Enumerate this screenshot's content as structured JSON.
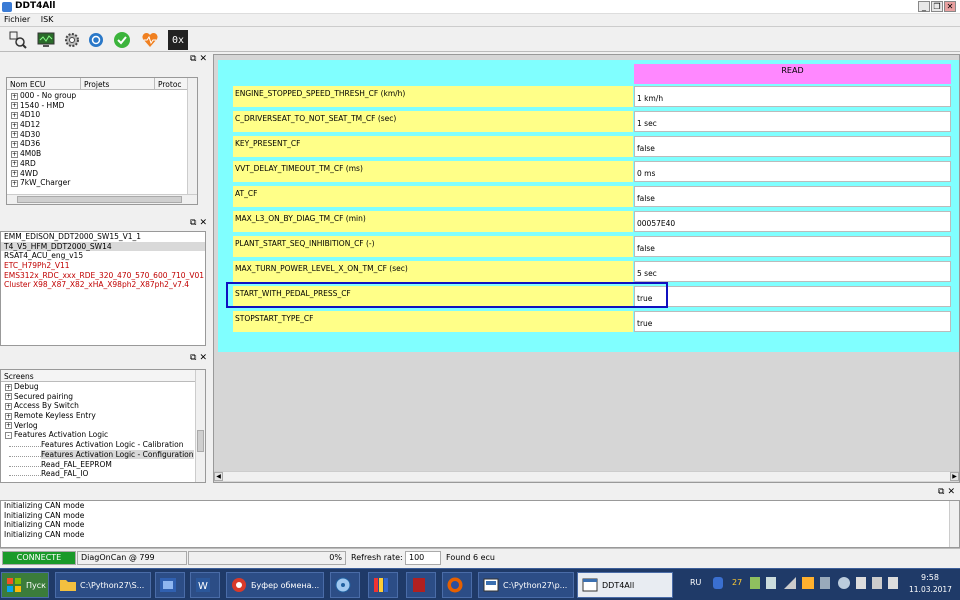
{
  "window": {
    "title": "DDT4All",
    "minimize": "_",
    "restore": "❐",
    "close": "✕"
  },
  "menu": [
    "Fichier",
    "ISK"
  ],
  "toolbar": {
    "hex_label": "0x"
  },
  "ecu_panel": {
    "headers": [
      "Nom ECU",
      "Projets",
      "Protoc"
    ],
    "items": [
      "000 - No group",
      "1540 - HMD",
      "4D10",
      "4D12",
      "4D30",
      "4D36",
      "4M0B",
      "4RD",
      "4WD",
      "7kW_Charger"
    ]
  },
  "files_panel": {
    "items": [
      {
        "text": "EMM_EDISON_DDT2000_SW15_V1_1",
        "color": "#000000"
      },
      {
        "text": "T4_V5_HFM_DDT2000_SW14",
        "color": "#000000"
      },
      {
        "text": "RSAT4_ACU_eng_v15",
        "color": "#000000"
      },
      {
        "text": "ETC_H79Ph2_V11",
        "color": "#c00000"
      },
      {
        "text": "EMS312x_RDC_xxx_RDE_320_470_570_600_710_V01",
        "color": "#c00000"
      },
      {
        "text": "Cluster X98_X87_X82_xHA_X98ph2_X87ph2_v7.4",
        "color": "#c00000"
      }
    ]
  },
  "screens_panel": {
    "header": "Screens",
    "items": [
      {
        "text": "Debug",
        "level": 0,
        "expander": "+"
      },
      {
        "text": "Secured pairing",
        "level": 0,
        "expander": "+"
      },
      {
        "text": "Access By Switch",
        "level": 0,
        "expander": "+"
      },
      {
        "text": "Remote Keyless Entry",
        "level": 0,
        "expander": "+"
      },
      {
        "text": "Verlog",
        "level": 0,
        "expander": "+"
      },
      {
        "text": "Features Activation Logic",
        "level": 0,
        "expander": "-"
      },
      {
        "text": "Features Activation Logic - Calibration",
        "level": 1,
        "expander": ""
      },
      {
        "text": "Features Activation Logic - Configuration",
        "level": 1,
        "expander": "",
        "selected": true
      },
      {
        "text": "Read_FAL_EEPROM",
        "level": 1,
        "expander": ""
      },
      {
        "text": "Read_FAL_IO",
        "level": 1,
        "expander": ""
      }
    ]
  },
  "params": {
    "read_header": "READ",
    "rows": [
      {
        "name": "ENGINE_STOPPED_SPEED_THRESH_CF (km/h)",
        "value": "1 km/h"
      },
      {
        "name": "C_DRIVERSEAT_TO_NOT_SEAT_TM_CF (sec)",
        "value": "1 sec"
      },
      {
        "name": "KEY_PRESENT_CF",
        "value": "false"
      },
      {
        "name": "VVT_DELAY_TIMEOUT_TM_CF (ms)",
        "value": "0 ms"
      },
      {
        "name": "AT_CF",
        "value": "false"
      },
      {
        "name": "MAX_L3_ON_BY_DIAG_TM_CF (min)",
        "value": "00057E40"
      },
      {
        "name": "PLANT_START_SEQ_INHIBITION_CF (-)",
        "value": "false"
      },
      {
        "name": "MAX_TURN_POWER_LEVEL_X_ON_TM_CF (sec)",
        "value": "5 sec"
      },
      {
        "name": "START_WITH_PEDAL_PRESS_CF",
        "value": "true"
      },
      {
        "name": "STOPSTART_TYPE_CF",
        "value": "true"
      }
    ]
  },
  "log": {
    "lines": [
      "Initializing CAN mode",
      "Initializing CAN mode",
      "Initializing CAN mode",
      "Initializing CAN mode"
    ]
  },
  "status": {
    "connected": "CONNECTE",
    "adapter": "DiagOnCan @ 799",
    "progress": "0%",
    "refresh_label": "Refresh rate:",
    "refresh_value": "100",
    "found": "Found 6 ecu"
  },
  "taskbar": {
    "start": "Пуск",
    "tasks": [
      "C:\\Python27\\S...",
      "Буфер обмена...",
      "C:\\Python27\\p...",
      "DDT4All"
    ],
    "lang": "RU",
    "time": "9:58",
    "date": "11.03.2017",
    "tray_num": "27"
  }
}
